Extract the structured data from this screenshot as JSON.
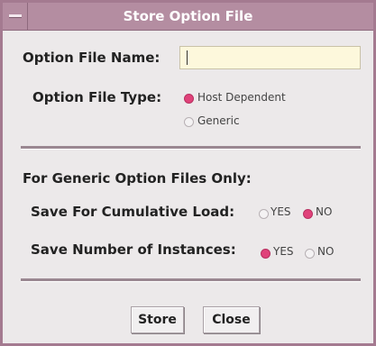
{
  "window": {
    "title": "Store Option File"
  },
  "option_file_name": {
    "label": "Option File Name:",
    "value": ""
  },
  "option_file_type": {
    "label": "Option File Type:",
    "options": [
      "Host Dependent",
      "Generic"
    ],
    "selected": "Host Dependent"
  },
  "generic_section": {
    "heading": "For Generic Option Files Only:",
    "cumulative_load": {
      "label": "Save For Cumulative Load:",
      "yes": "YES",
      "no": "NO",
      "selected": "NO"
    },
    "number_of_instances": {
      "label": "Save Number of Instances:",
      "yes": "YES",
      "no": "NO",
      "selected": "YES"
    }
  },
  "buttons": {
    "store": "Store",
    "close": "Close"
  },
  "colors": {
    "titlebar": "#b48da1",
    "accent_radio": "#e0427a",
    "field_bg": "#fdf8dc"
  }
}
